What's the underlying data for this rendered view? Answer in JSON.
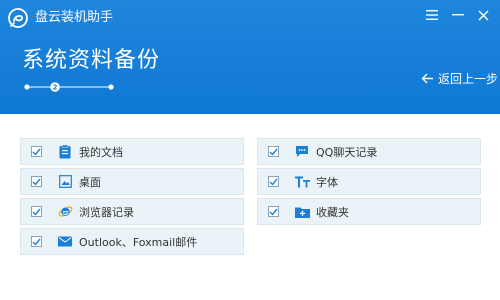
{
  "app": {
    "title": "盘云装机助手"
  },
  "step": {
    "title": "系统资料备份",
    "current": "2",
    "total_steps": 3
  },
  "nav": {
    "back_label": "返回上一步"
  },
  "backup_items": {
    "left": [
      {
        "label": "我的文档",
        "icon": "document-icon",
        "checked": true
      },
      {
        "label": "桌面",
        "icon": "desktop-icon",
        "checked": true
      },
      {
        "label": "浏览器记录",
        "icon": "ie-browser-icon",
        "checked": true
      },
      {
        "label": "Outlook、Foxmail邮件",
        "icon": "mail-icon",
        "checked": true
      }
    ],
    "right": [
      {
        "label": "QQ聊天记录",
        "icon": "chat-icon",
        "checked": true
      },
      {
        "label": "字体",
        "icon": "font-icon",
        "checked": true
      },
      {
        "label": "收藏夹",
        "icon": "favorites-folder-icon",
        "checked": true
      }
    ]
  },
  "colors": {
    "header_blue": "#1581d9",
    "icon_blue": "#1c7fd6",
    "item_bg": "#eaf3f8"
  }
}
